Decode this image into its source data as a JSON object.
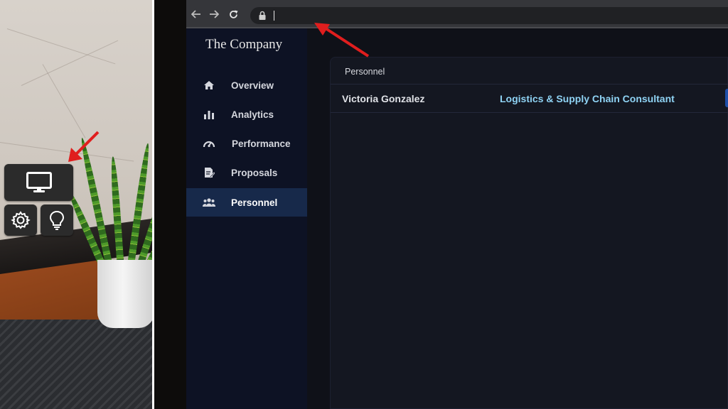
{
  "browser": {
    "address_value": "",
    "toolbar_icons": [
      "back-icon",
      "forward-icon",
      "reload-icon",
      "lock-icon"
    ]
  },
  "app": {
    "brand": "The Company",
    "nav": [
      {
        "label": "Overview",
        "icon": "home-icon"
      },
      {
        "label": "Analytics",
        "icon": "bar-chart-icon"
      },
      {
        "label": "Performance",
        "icon": "gauge-icon"
      },
      {
        "label": "Proposals",
        "icon": "document-edit-icon"
      },
      {
        "label": "Personnel",
        "icon": "users-icon",
        "active": true
      }
    ],
    "personnel": {
      "title": "Personnel",
      "rows": [
        {
          "name": "Victoria Gonzalez",
          "role": "Logistics & Supply Chain Consultant"
        }
      ]
    }
  },
  "hud": {
    "buttons": [
      "monitor-icon",
      "gear-icon",
      "lightbulb-icon"
    ]
  },
  "colors": {
    "accent_role": "#8fd3f4",
    "active_nav": "#17294a",
    "annotation_arrow": "#e01e1e"
  }
}
